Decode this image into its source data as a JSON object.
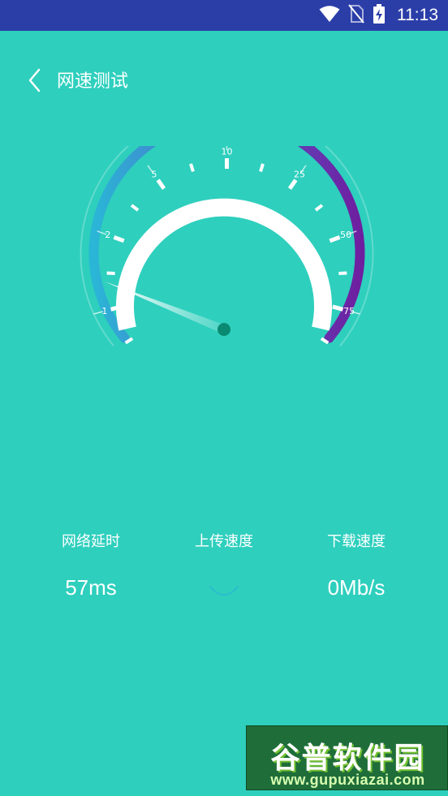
{
  "status_bar": {
    "time": "11:13",
    "icons": [
      "wifi-icon",
      "no-sim-icon",
      "battery-charging-icon"
    ],
    "background": "#2b3ea8"
  },
  "header": {
    "title": "网速测试",
    "back_icon": "chevron-left-icon"
  },
  "gauge": {
    "scale_labels": [
      "0",
      "1",
      "2",
      "5",
      "10",
      "25",
      "50",
      "75",
      "100"
    ],
    "needle_value": "1",
    "arc_gradient": [
      "#2ab6d6",
      "#5a57c8",
      "#6e1fa0"
    ]
  },
  "stats": {
    "latency": {
      "label": "网络延时",
      "value": "57ms"
    },
    "upload": {
      "label": "上传速度",
      "value": ""
    },
    "download": {
      "label": "下载速度",
      "value": "0Mb/s"
    }
  },
  "watermark": {
    "brand": "谷普软件园",
    "url": "www.gupuxiazai.com"
  },
  "colors": {
    "background": "#2ecfbd",
    "accent": "#6e1fa0"
  }
}
